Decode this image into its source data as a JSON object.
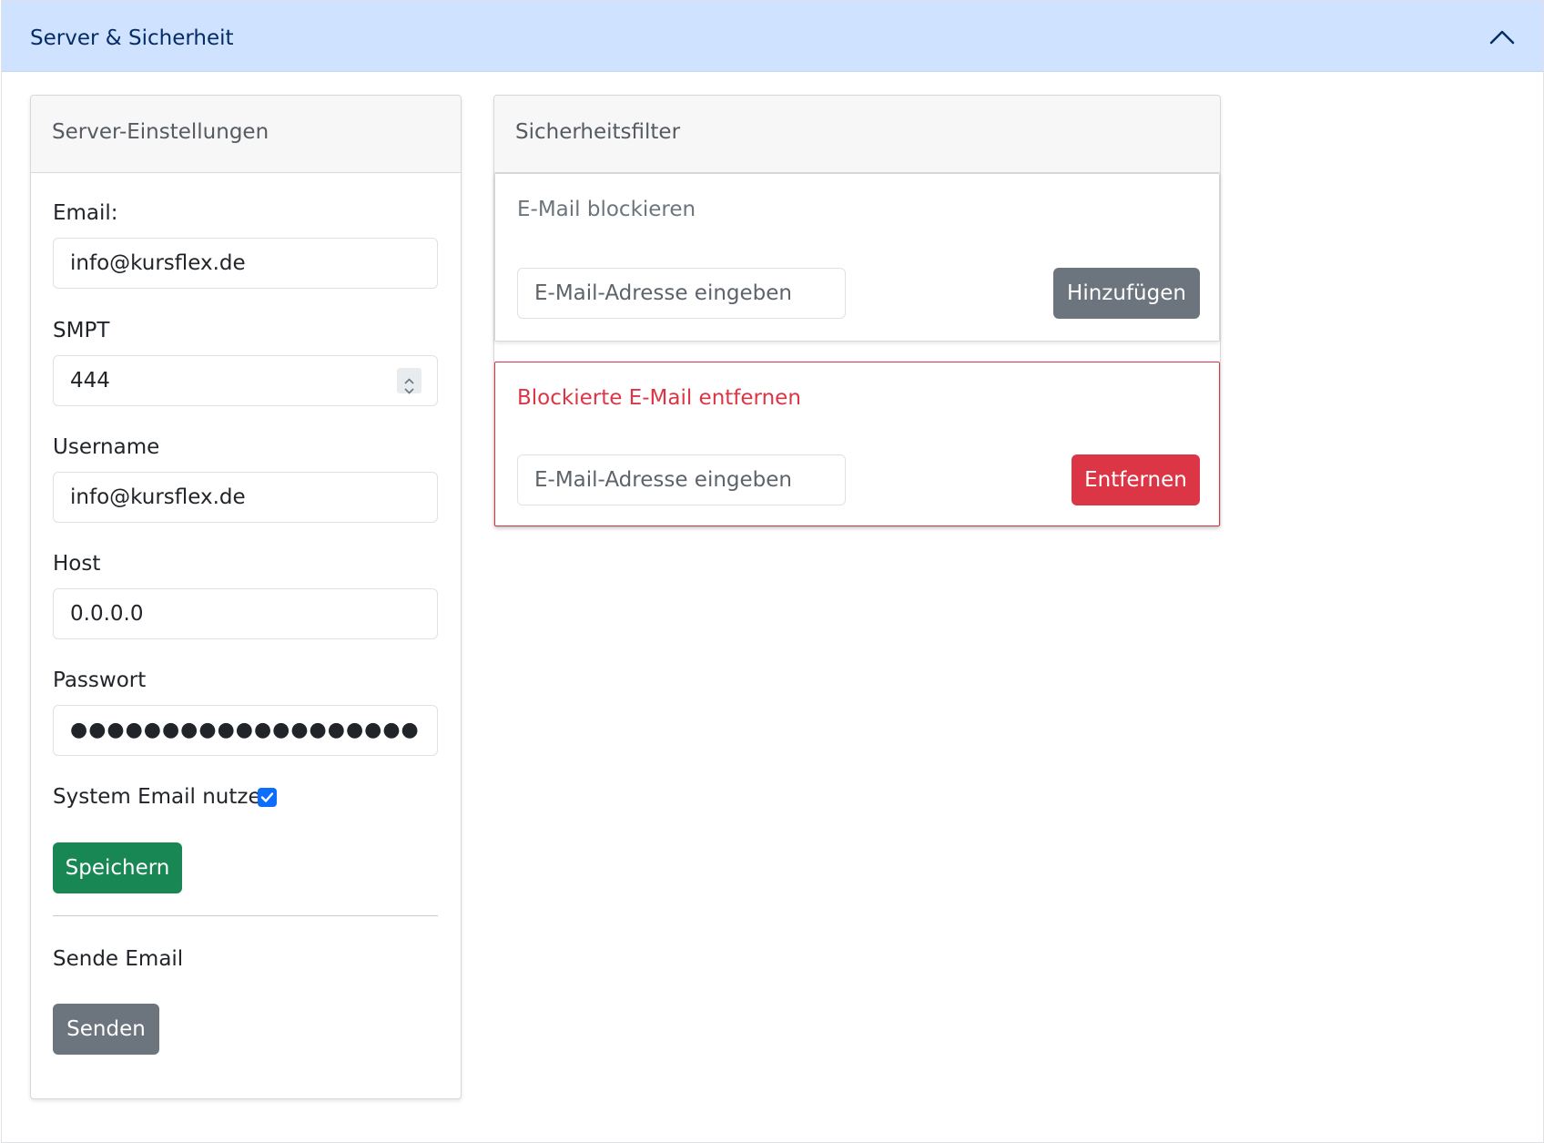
{
  "accordion": {
    "title": "Server & Sicherheit",
    "toggle_icon": "chevron-up-icon"
  },
  "server_settings": {
    "header": "Server-Einstellungen",
    "email_label": "Email:",
    "email_value": "info@kursflex.de",
    "smpt_label": "SMPT",
    "smpt_value": "444",
    "username_label": "Username",
    "username_value": "info@kursflex.de",
    "host_label": "Host",
    "host_value": "0.0.0.0",
    "password_label": "Passwort",
    "password_mask": "●●●●●●●●●●●●●●●●●●●●●●●●●●●●●●●●",
    "system_email_label": "System Email nutzen",
    "system_email_checked": true,
    "save_button": "Speichern",
    "send_section_title": "Sende Email",
    "send_button": "Senden"
  },
  "security_filter": {
    "header": "Sicherheitsfilter",
    "block": {
      "title": "E-Mail blockieren",
      "placeholder": "E-Mail-Adresse eingeben",
      "button": "Hinzufügen"
    },
    "unblock": {
      "title": "Blockierte E-Mail entfernen",
      "placeholder": "E-Mail-Adresse eingeben",
      "button": "Entfernen"
    }
  },
  "colors": {
    "accordion_bg": "#cfe2ff",
    "primary": "#0d6efd",
    "success": "#198754",
    "secondary": "#6c757d",
    "danger": "#dc3545"
  }
}
